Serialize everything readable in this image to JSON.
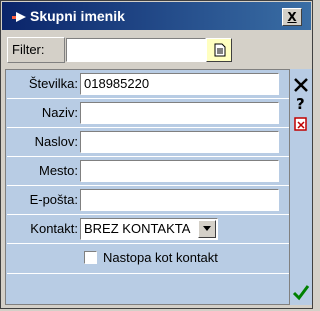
{
  "window": {
    "title": "Skupni imenik",
    "close_label": "X"
  },
  "filter": {
    "label": "Filter:",
    "value": ""
  },
  "form": {
    "fields": [
      {
        "label": "Številka:",
        "value": "018985220"
      },
      {
        "label": "Naziv:",
        "value": ""
      },
      {
        "label": "Naslov:",
        "value": ""
      },
      {
        "label": "Mesto:",
        "value": ""
      },
      {
        "label": "E-pošta:",
        "value": ""
      }
    ],
    "kontakt": {
      "label": "Kontakt:",
      "selected": "BREZ KONTAKTA"
    },
    "checkbox": {
      "label": "Nastopa kot kontakt",
      "checked": false
    }
  },
  "toolbar": {
    "icons": [
      "close-icon",
      "help-icon",
      "delete-icon",
      "confirm-icon"
    ]
  }
}
